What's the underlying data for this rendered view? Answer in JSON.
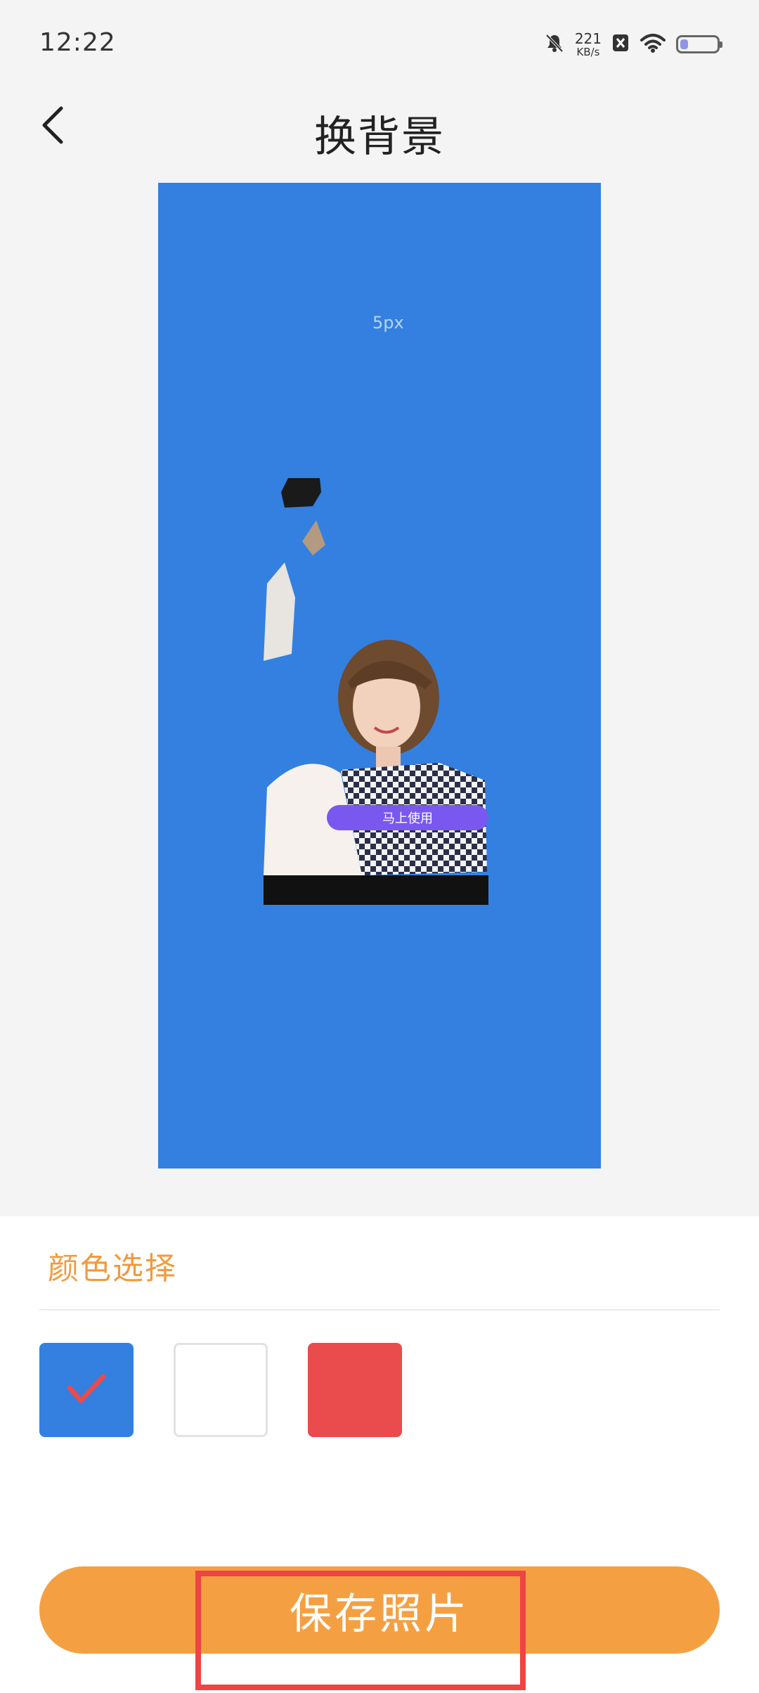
{
  "status_bar": {
    "time": "12:22",
    "network_speed": "221",
    "network_speed_unit": "KB/s",
    "icons": [
      "mute-bell-icon",
      "sim-off-icon",
      "wifi-icon",
      "battery-icon"
    ]
  },
  "header": {
    "back_icon": "chevron-left-icon",
    "title": "换背景"
  },
  "preview": {
    "watermark_text": "5px",
    "overlay_button_label": "马上使用",
    "background_color": "#3380e0"
  },
  "color_panel": {
    "title": "颜色选择",
    "swatches": [
      {
        "name": "blue",
        "color": "#3380e0",
        "selected": true
      },
      {
        "name": "white",
        "color": "#ffffff",
        "selected": false
      },
      {
        "name": "red",
        "color": "#ea4b4d",
        "selected": false
      }
    ],
    "check_icon": "checkmark-icon",
    "check_color": "#ea4b4d"
  },
  "actions": {
    "save_label": "保存照片",
    "save_color": "#f4a042"
  },
  "annotation": {
    "highlight_color": "#ee4444"
  }
}
